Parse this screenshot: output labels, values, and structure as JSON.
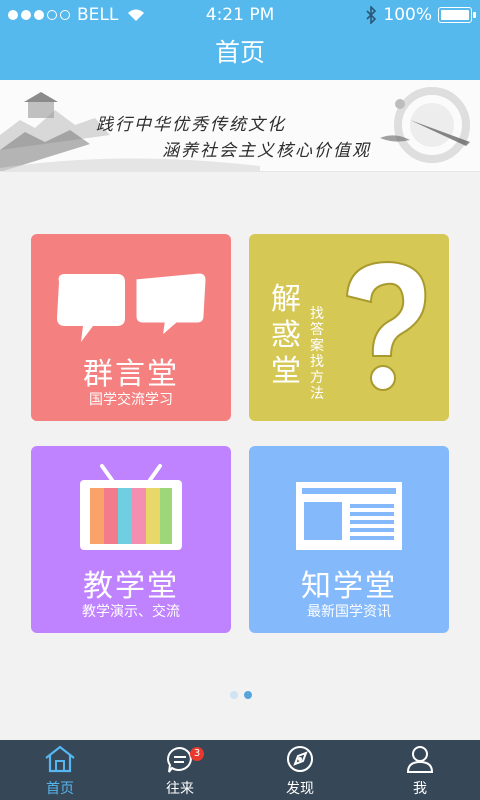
{
  "status_bar": {
    "carrier": "BELL",
    "time": "4:21 PM",
    "battery": "100%",
    "signal_bars": 3,
    "signal_total": 5
  },
  "nav": {
    "title": "首页"
  },
  "banner": {
    "line1": "践行中华优秀传统文化",
    "line2": "涵养社会主义核心价值观"
  },
  "tiles": [
    {
      "title": "群言堂",
      "subtitle": "国学交流学习",
      "color": "#f48080",
      "icon": "speech-bubbles-icon"
    },
    {
      "title": "解惑堂",
      "subtitle": "找答案找方法",
      "color": "#d6c854",
      "icon": "question-mark-icon"
    },
    {
      "title": "教学堂",
      "subtitle": "教学演示、交流",
      "color": "#c083ff",
      "icon": "tv-icon"
    },
    {
      "title": "知学堂",
      "subtitle": "最新国学资讯",
      "color": "#84b9fc",
      "icon": "newspaper-icon"
    }
  ],
  "pager": {
    "pages": 2,
    "active_index": 1
  },
  "tabs": [
    {
      "label": "首页",
      "icon": "home-icon",
      "active": true
    },
    {
      "label": "往来",
      "icon": "chat-icon",
      "badge": "3"
    },
    {
      "label": "发现",
      "icon": "compass-icon"
    },
    {
      "label": "我",
      "icon": "profile-icon"
    }
  ],
  "colors": {
    "primary": "#55b9ee",
    "tabbar": "#364758",
    "tab_active": "#56b6f0",
    "badge": "#e8392f"
  }
}
